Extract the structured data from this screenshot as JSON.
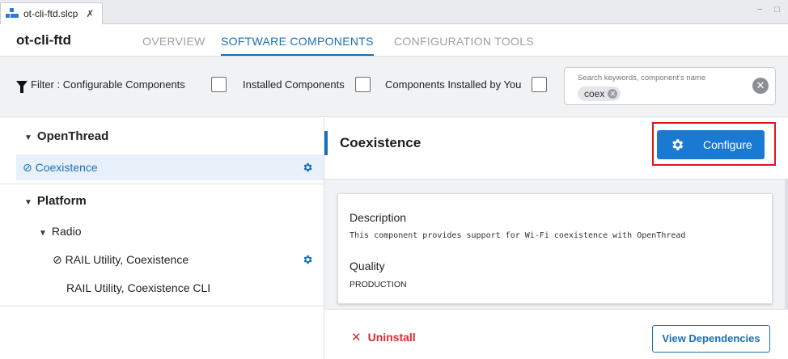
{
  "editor_tab": {
    "filename": "ot-cli-ftd.slcp",
    "close_glyph": "✗"
  },
  "window_controls": "− □",
  "header": {
    "project_title": "ot-cli-ftd",
    "tabs": [
      {
        "label": "OVERVIEW",
        "active": false
      },
      {
        "label": "SOFTWARE COMPONENTS",
        "active": true
      },
      {
        "label": "CONFIGURATION TOOLS",
        "active": false
      }
    ]
  },
  "filter": {
    "prefix": "Filter :",
    "options": [
      {
        "label": "Configurable Components",
        "checked": false
      },
      {
        "label": "Installed Components",
        "checked": false
      },
      {
        "label": "Components Installed by You",
        "checked": false
      }
    ]
  },
  "search": {
    "placeholder": "Search keywords, component's name",
    "chip": "coex"
  },
  "tree": {
    "groups": [
      {
        "label": "OpenThread",
        "items": [
          {
            "label": "Coexistence",
            "installed": true,
            "selected": true,
            "configurable": true
          }
        ]
      },
      {
        "label": "Platform",
        "subgroups": [
          {
            "label": "Radio",
            "items": [
              {
                "label": "RAIL Utility, Coexistence",
                "installed": true,
                "configurable": true
              },
              {
                "label": "RAIL Utility, Coexistence CLI",
                "installed": false,
                "configurable": false
              }
            ]
          }
        ]
      }
    ]
  },
  "detail": {
    "title": "Coexistence",
    "configure_label": "Configure",
    "description_heading": "Description",
    "description_text": "This component provides support for Wi-Fi coexistence with OpenThread",
    "quality_heading": "Quality",
    "quality_value": "PRODUCTION",
    "uninstall_label": "Uninstall",
    "view_dependencies_label": "View Dependencies"
  },
  "colors": {
    "accent": "#1a6fb6",
    "configure_button": "#1a7ad1",
    "highlight_box": "#e0141c",
    "uninstall": "#d32f2f"
  }
}
